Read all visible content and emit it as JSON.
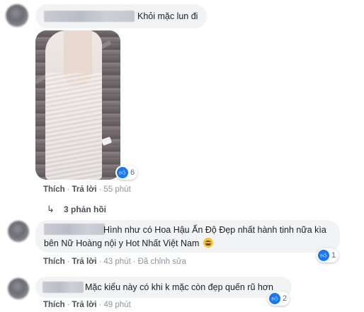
{
  "comments": [
    {
      "text": "Khỏi mặc lun đi",
      "reaction_count": "6",
      "actions": {
        "like": "Thích",
        "reply": "Trả lời",
        "time": "55 phút"
      },
      "replies_link": "3 phản hồi"
    },
    {
      "text_line1": "Hình như có Hoa Hậu Ấn Độ Đẹp nhất hành tinh nữa kìa",
      "text_line2": "bên Nữ Hoàng nội y Hot Nhất Việt Nam",
      "reaction_count": "1",
      "actions": {
        "like": "Thích",
        "reply": "Trả lời",
        "time": "43 phút",
        "edited": "Đã chỉnh sửa"
      }
    },
    {
      "text": "Mặc kiểu này có khi k mặc còn đẹp quến rũ hơn",
      "reaction_count": "2",
      "actions": {
        "like": "Thích",
        "reply": "Trả lời",
        "time": "49 phút"
      }
    }
  ],
  "icons": {
    "reaction": "like-icon",
    "reply": "reply-arrow-icon",
    "emoji": "grinning-face-emoji"
  },
  "colors": {
    "like_blue": "#1877f2",
    "bubble": "#f2f3f5",
    "meta": "#90949c"
  }
}
